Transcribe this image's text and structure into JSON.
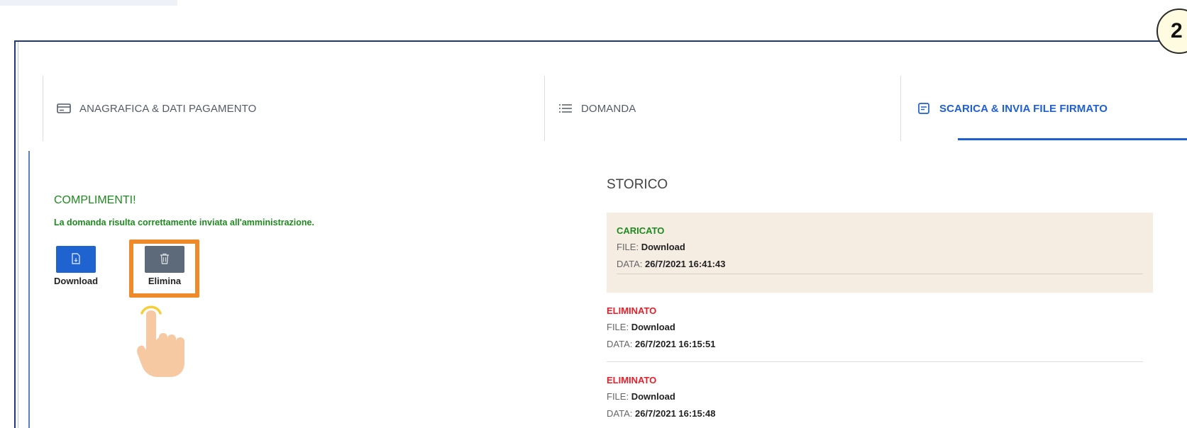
{
  "step_badge": "2",
  "tabs": [
    {
      "label": "ANAGRAFICA & DATI PAGAMENTO",
      "icon": "card-icon",
      "active": false
    },
    {
      "label": "DOMANDA",
      "icon": "list-icon",
      "active": false
    },
    {
      "label": "SCARICA & INVIA FILE FIRMATO",
      "icon": "document-icon",
      "active": true
    }
  ],
  "success": {
    "title": "COMPLIMENTI!",
    "message": "La domanda risulta correttamente inviata all'amministrazione."
  },
  "actions": {
    "download_label": "Download",
    "delete_label": "Elimina"
  },
  "history": {
    "title": "STORICO",
    "file_prefix": "FILE:",
    "date_prefix": "DATA:",
    "entries": [
      {
        "status": "CARICATO",
        "file": "Download",
        "date": "26/7/2021 16:41:43"
      },
      {
        "status": "ELIMINATO",
        "file": "Download",
        "date": "26/7/2021 16:15:51"
      },
      {
        "status": "ELIMINATO",
        "file": "Download",
        "date": "26/7/2021 16:15:48"
      }
    ]
  },
  "colors": {
    "accent": "#1f5fd0",
    "success": "#1f8a1f",
    "deleted": "#e0202a",
    "highlight": "#ef8a2a"
  }
}
